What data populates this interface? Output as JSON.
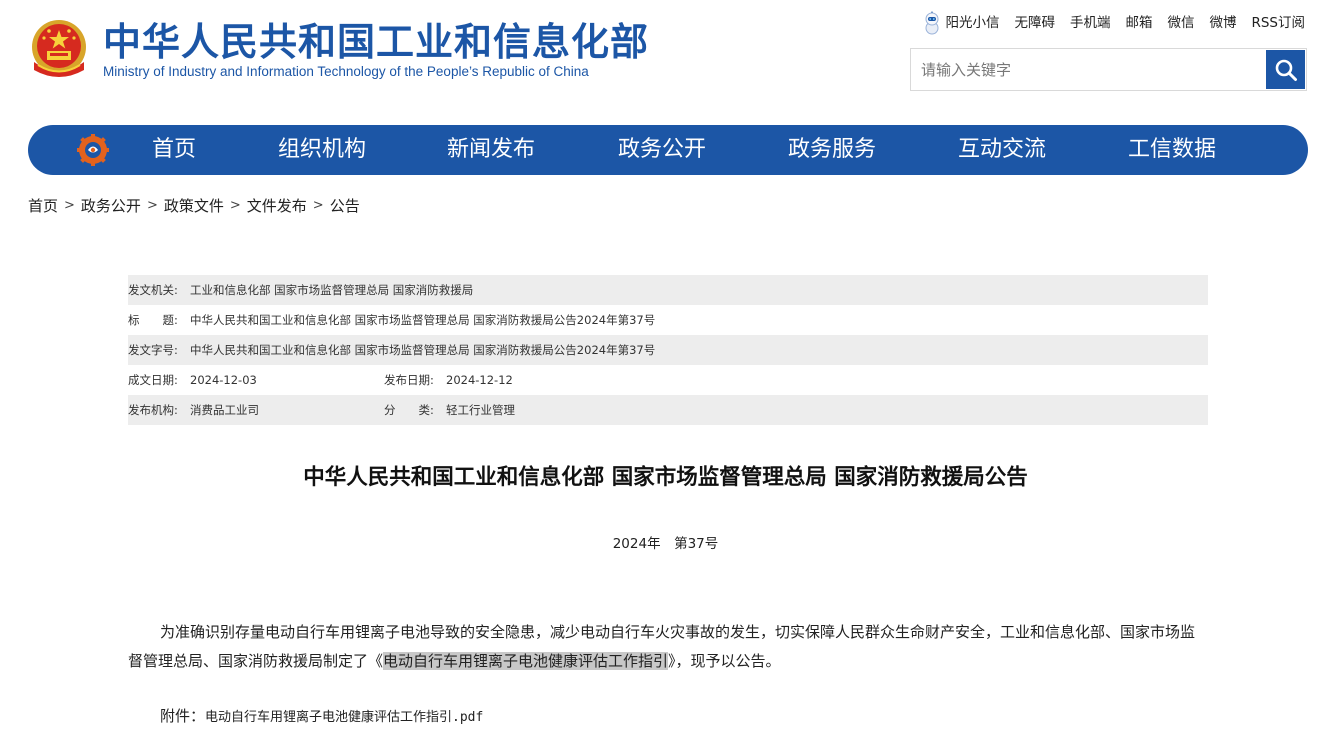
{
  "header": {
    "title": "中华人民共和国工业和信息化部",
    "subtitle": "Ministry of Industry and Information Technology of the People’s Republic of China",
    "brand_color": "#1c56a6"
  },
  "top_links": {
    "sunshine": "阳光小信",
    "accessibility": "无障碍",
    "mobile": "手机端",
    "mail": "邮箱",
    "wechat": "微信",
    "weibo": "微博",
    "rss": "RSS订阅"
  },
  "search": {
    "placeholder": "请输入关键字",
    "value": "",
    "button_icon": "search-icon"
  },
  "nav": {
    "home": "首页",
    "org": "组织机构",
    "news": "新闻发布",
    "affairs": "政务公开",
    "services": "政务服务",
    "interaction": "互动交流",
    "data": "工信数据"
  },
  "breadcrumb": {
    "items": [
      "首页",
      "政务公开",
      "政策文件",
      "文件发布",
      "公告"
    ],
    "separator": ">"
  },
  "meta": {
    "issuer_label": "发文机关:",
    "issuer": "工业和信息化部 国家市场监督管理总局 国家消防救援局",
    "title_label": "标　　题:",
    "title": "中华人民共和国工业和信息化部 国家市场监督管理总局 国家消防救援局公告2024年第37号",
    "docno_label": "发文字号:",
    "docno": "中华人民共和国工业和信息化部 国家市场监督管理总局 国家消防救援局公告2024年第37号",
    "written_label": "成文日期:",
    "written": "2024-12-03",
    "published_label": "发布日期:",
    "published": "2024-12-12",
    "org_label": "发布机构:",
    "org": "消费品工业司",
    "category_label": "分　　类:",
    "category": "轻工行业管理"
  },
  "article": {
    "title": "中华人民共和国工业和信息化部 国家市场监督管理总局 国家消防救援局公告",
    "number": "2024年　第37号",
    "body_before": "为准确识别存量电动自行车用锂离子电池导致的安全隐患，减少电动自行车火灾事故的发生，切实保障人民群众生命财产安全，工业和信息化部、国家市场监督管理总局、国家消防救援局制定了《",
    "body_highlight": "电动自行车用锂离子电池健康评估工作指引",
    "body_after": "》，现予以公告。",
    "attachment_label": "附件：",
    "attachment_file": "电动自行车用锂离子电池健康评估工作指引.pdf"
  }
}
